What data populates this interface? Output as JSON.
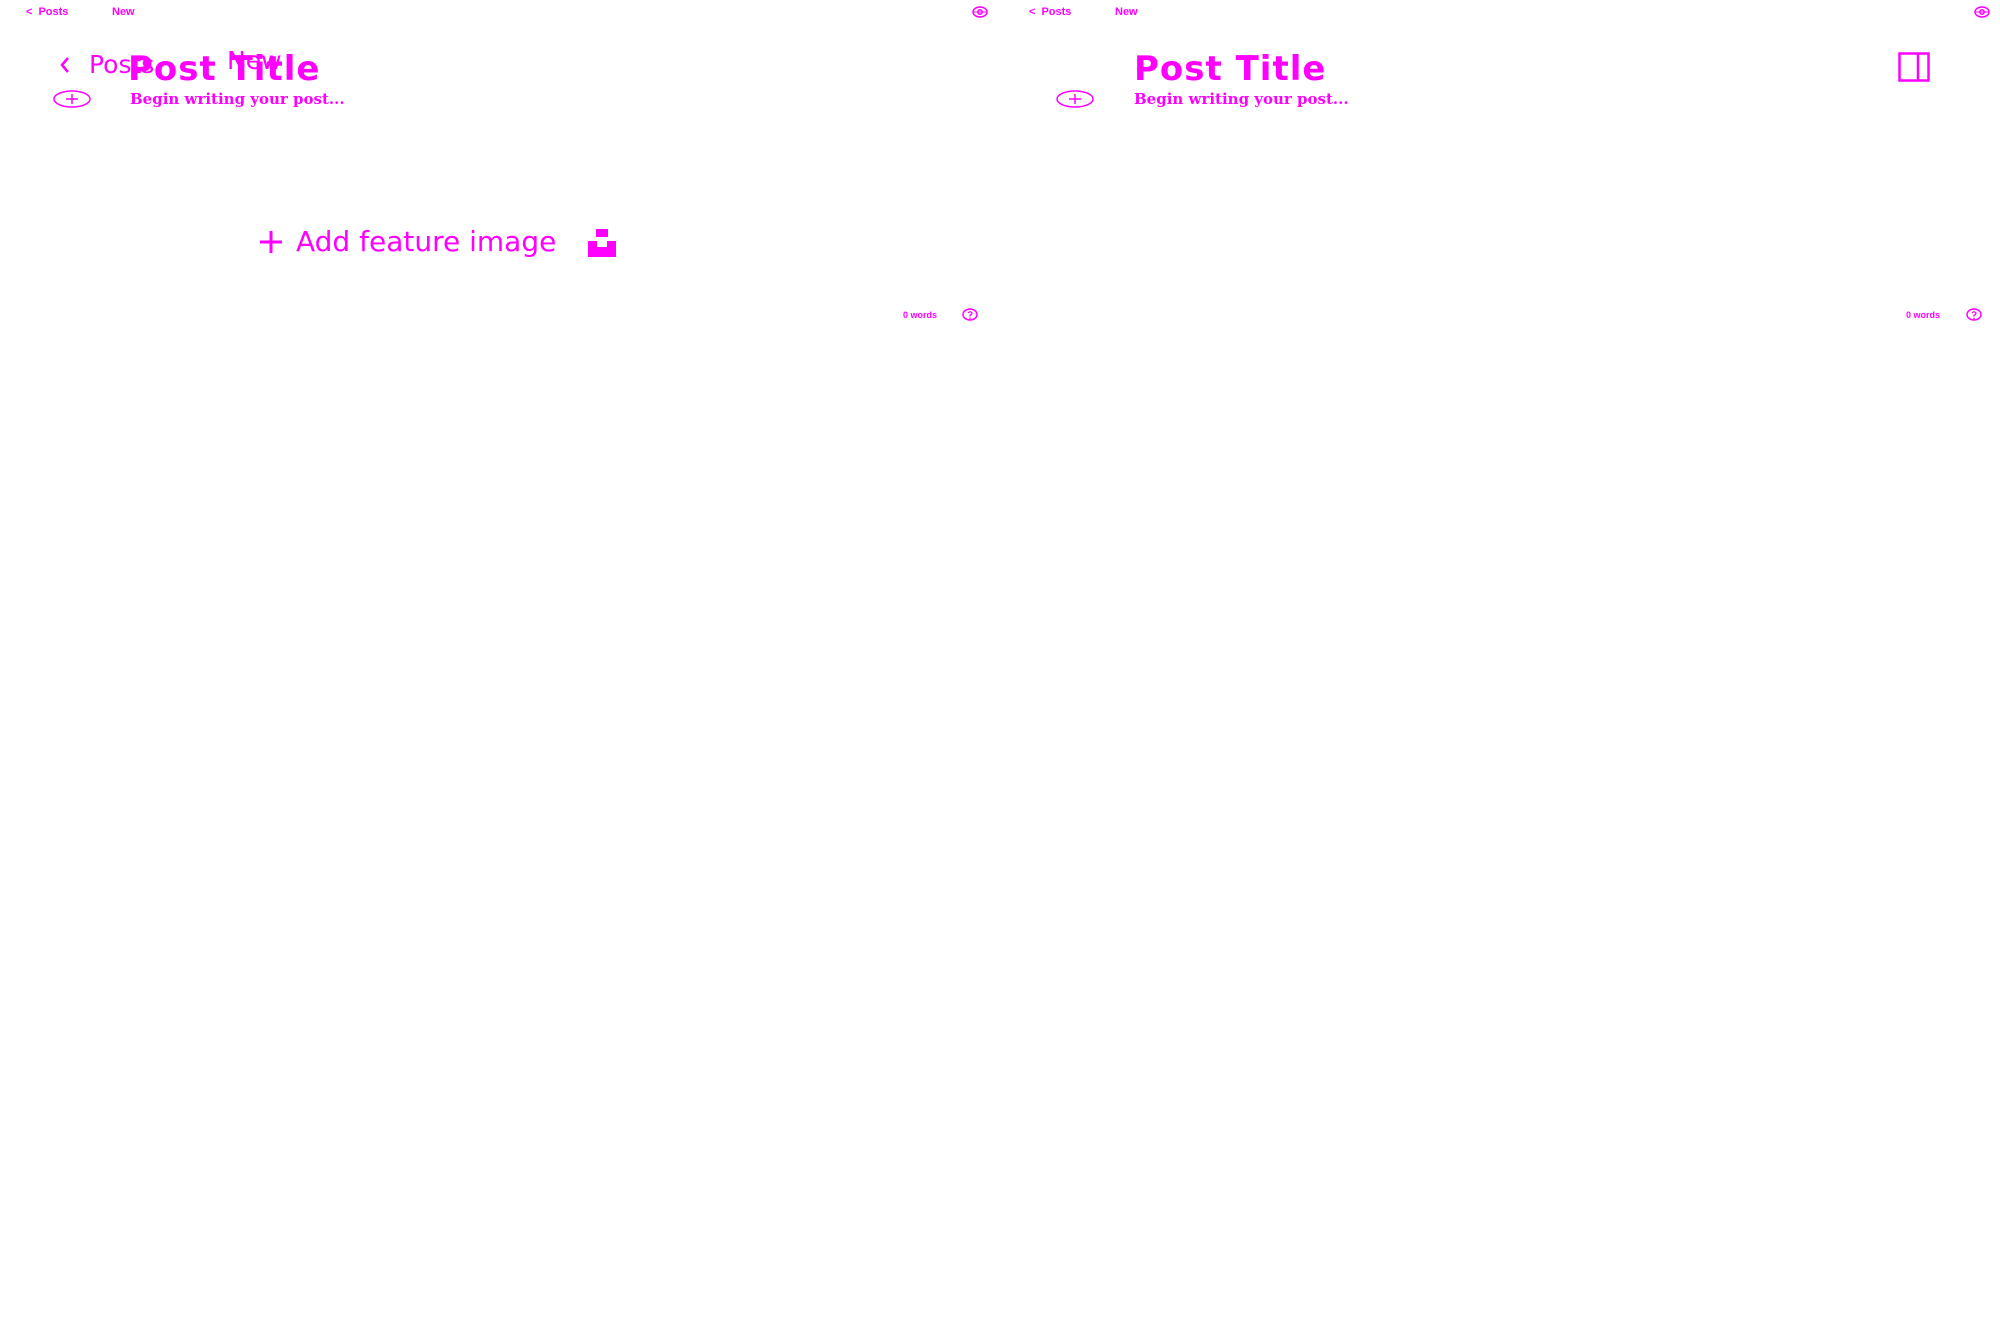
{
  "colors": {
    "accent": "#ff00ff",
    "background": "#ffffff"
  },
  "header": {
    "back_label": "Posts",
    "status_label": "New",
    "settings_icon": "settings-icon"
  },
  "overlay_nav": {
    "back_label": "Posts",
    "status_label": "New",
    "back_icon": "chevron-left-icon"
  },
  "editor": {
    "title_placeholder": "Post Title",
    "body_placeholder": "Begin writing your post...",
    "add_card_icon": "plus-circle-icon"
  },
  "feature_image": {
    "label": "Add feature image",
    "plus_icon": "plus-icon",
    "unsplash_icon": "unsplash-icon"
  },
  "footer": {
    "word_count": "0 words",
    "help_icon": "help-icon"
  },
  "sidebar_toggle_icon": "sidebar-toggle-icon"
}
